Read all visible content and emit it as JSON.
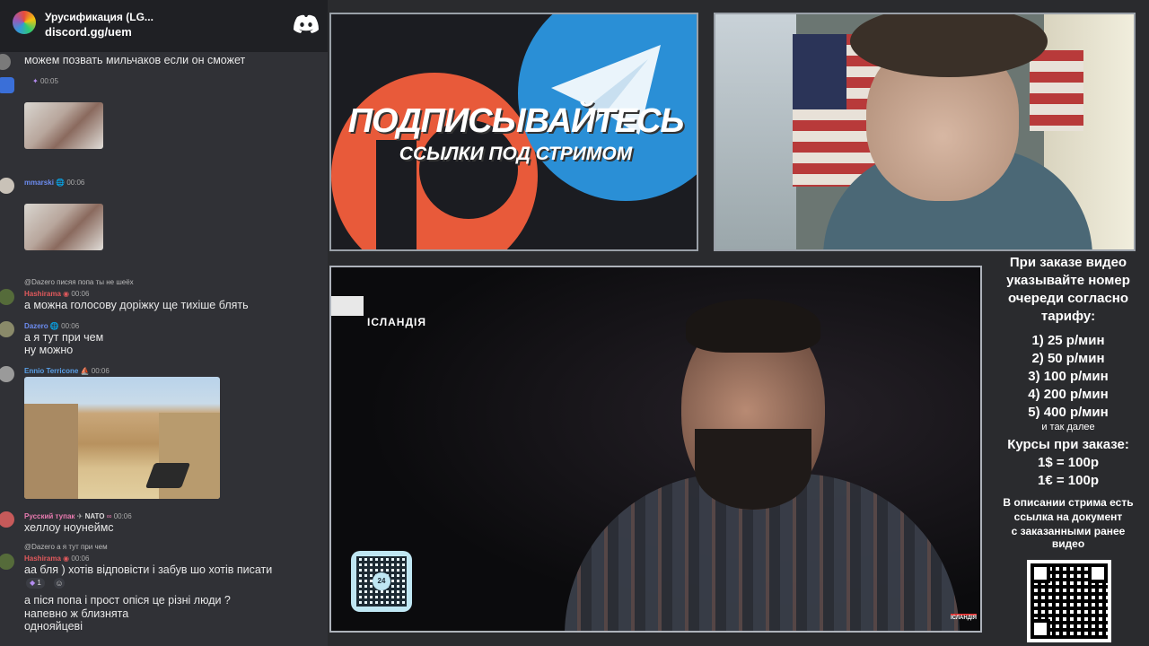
{
  "server": {
    "name": "Урусификация (LG...",
    "link": "discord.gg/uem"
  },
  "chat": {
    "m1_text": "можем позвать мильчаков если он сможет",
    "m2_time": "00:05",
    "m3_user": "mmarski",
    "m3_time": "00:06",
    "m4_reply": "@Dazero писяя попа ты не шеёх",
    "m4_user": "Hashirama",
    "m4_time": "00:06",
    "m4_text": "а можна голосову доріжку ще тихіше блять",
    "m5_user": "Dazero",
    "m5_time": "00:06",
    "m5_line1": "а я тут при чем",
    "m5_line2": "ну можно",
    "m6_user": "Ennio Terricone",
    "m6_time": "00:06",
    "m7_user": "Русский тупак",
    "m7_tag": "NATO",
    "m7_time": "00:06",
    "m7_text": "хеллоу ноунеймс",
    "m8_reply": "@Dazero а я тут при чем",
    "m8_user": "Hashirama",
    "m8_time": "00:06",
    "m8_text": "аа бля ) хотів відповісти і забув шо хотів писати",
    "m8_react_count": "1",
    "m9_line1": "а піся попа і прост опіся це різні люди ?",
    "m9_line2": "напевно ж близнята",
    "m9_line3": "однояйцеві"
  },
  "promo": {
    "title": "ПОДПИСЫВАЙТЕСЬ",
    "subtitle": "ССЫЛКИ ПОД СТРИМОМ"
  },
  "video": {
    "channel": "ІСЛАНДІЯ",
    "watermark": "ІСЛАНДІЯ",
    "qr_label": "24"
  },
  "sidebar": {
    "intro": [
      "При заказе видео",
      "указывайте номер",
      "очереди согласно",
      "тарифу:"
    ],
    "tariffs": [
      "1) 25 р/мин",
      "2) 50 р/мин",
      "3) 100 р/мин",
      "4) 200 р/мин",
      "5) 400 р/мин"
    ],
    "etc": "и так далее",
    "rates_title": "Курсы при заказе:",
    "rates": [
      "1$ = 100р",
      "1€ = 100р"
    ],
    "desc": [
      "В описании стрима есть",
      "ссылка на документ",
      "с заказанными ранее",
      "видео"
    ]
  },
  "colors": {
    "hashirama": "#e0595c",
    "dazero": "#6c8cf0",
    "ennio": "#5aa0e8",
    "tupak": "#e87ab0",
    "telegram": "#2a8fd6",
    "patreon": "#e85a3a"
  }
}
